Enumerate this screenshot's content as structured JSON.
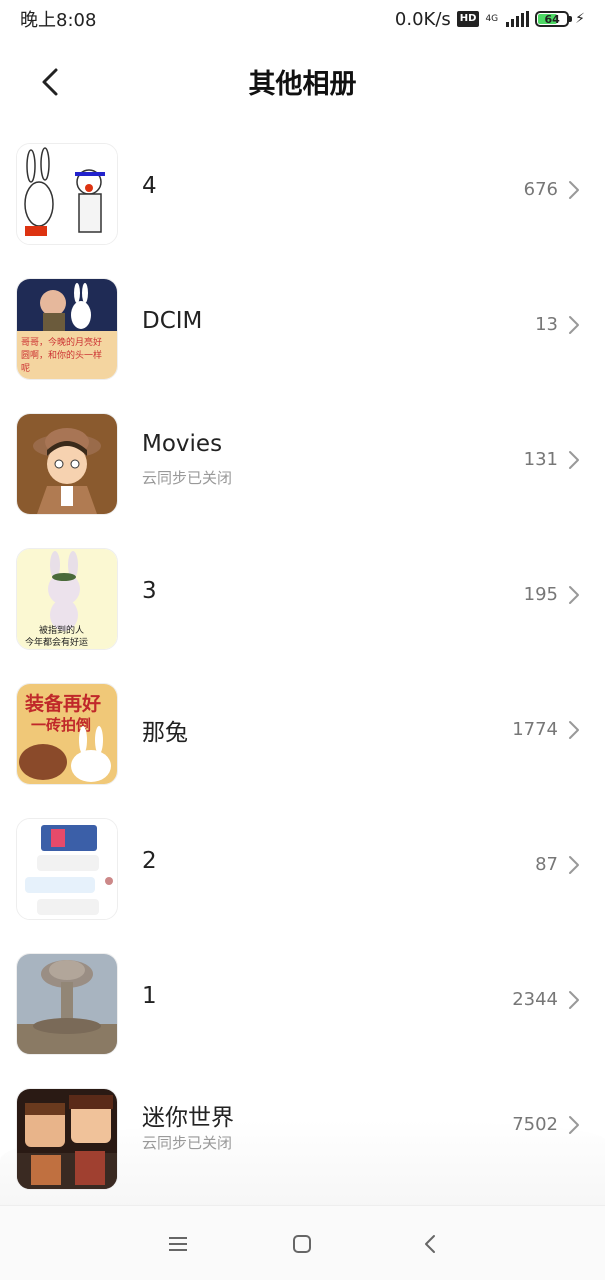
{
  "status_bar": {
    "time": "晚上8:08",
    "net_speed": "0.0K/s",
    "hd_badge": "HD",
    "network": "4G",
    "battery": "64",
    "battery_level": 0.64
  },
  "header": {
    "title": "其他相册",
    "back_icon": "chevron-left-icon"
  },
  "albums": [
    {
      "name": "4",
      "count": "676",
      "subtitle": ""
    },
    {
      "name": "DCIM",
      "count": "13",
      "subtitle": ""
    },
    {
      "name": "Movies",
      "count": "131",
      "subtitle": "云同步已关闭"
    },
    {
      "name": "3",
      "count": "195",
      "subtitle": ""
    },
    {
      "name": "那兔",
      "count": "1774",
      "subtitle": ""
    },
    {
      "name": "2",
      "count": "87",
      "subtitle": ""
    },
    {
      "name": "1",
      "count": "2344",
      "subtitle": ""
    },
    {
      "name": "迷你世界",
      "count": "7502",
      "subtitle": "云同步已关闭"
    }
  ],
  "thumb_text": {
    "dcim": "哥哥，今晚的月亮好圆啊，和你的头一样呢",
    "row3_line1": "被指到的人",
    "row3_line2": "今年都会有好运",
    "nt_line1": "装备再好",
    "nt_line2": "一砖拍倒"
  },
  "nav_bar": {
    "menu_icon": "menu-icon",
    "home_icon": "home-square-icon",
    "back_icon": "back-triangle-icon"
  }
}
